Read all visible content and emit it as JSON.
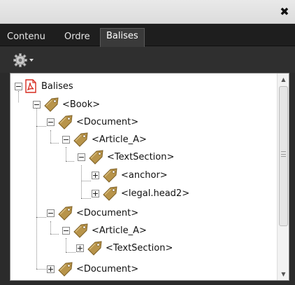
{
  "window": {
    "close_glyph": "✖"
  },
  "tabs": [
    {
      "label": "Contenu",
      "active": false
    },
    {
      "label": "Ordre",
      "active": false
    },
    {
      "label": "Balises",
      "active": true
    }
  ],
  "toolbar": {
    "options_icon": "gear-icon",
    "dropdown_icon": "triangle-down-icon"
  },
  "tree": {
    "nodes": [
      {
        "label": "Balises",
        "icon": "pdf-icon",
        "expanded": true,
        "depth": 0
      },
      {
        "label": "<Book>",
        "icon": "tag-icon",
        "expanded": true,
        "depth": 1
      },
      {
        "label": "<Document>",
        "icon": "tag-icon",
        "expanded": true,
        "depth": 2
      },
      {
        "label": "<Article_A>",
        "icon": "tag-icon",
        "expanded": true,
        "depth": 3
      },
      {
        "label": "<TextSection>",
        "icon": "tag-icon",
        "expanded": true,
        "depth": 4
      },
      {
        "label": "<anchor>",
        "icon": "tag-icon",
        "expanded": false,
        "depth": 5
      },
      {
        "label": "<legal.head2>",
        "icon": "tag-icon",
        "expanded": false,
        "depth": 5
      },
      {
        "label": "<Document>",
        "icon": "tag-icon",
        "expanded": true,
        "depth": 2
      },
      {
        "label": "<Article_A>",
        "icon": "tag-icon",
        "expanded": true,
        "depth": 3
      },
      {
        "label": "<TextSection>",
        "icon": "tag-icon",
        "expanded": false,
        "depth": 4
      },
      {
        "label": "<Document>",
        "icon": "tag-icon",
        "expanded": false,
        "depth": 2
      }
    ]
  },
  "scrollbar": {
    "up_glyph": "▲",
    "down_glyph": "▼"
  },
  "colors": {
    "tag_gold": "#b8944a",
    "tag_dark": "#7d5f24",
    "pdf_red": "#d62a1e"
  }
}
